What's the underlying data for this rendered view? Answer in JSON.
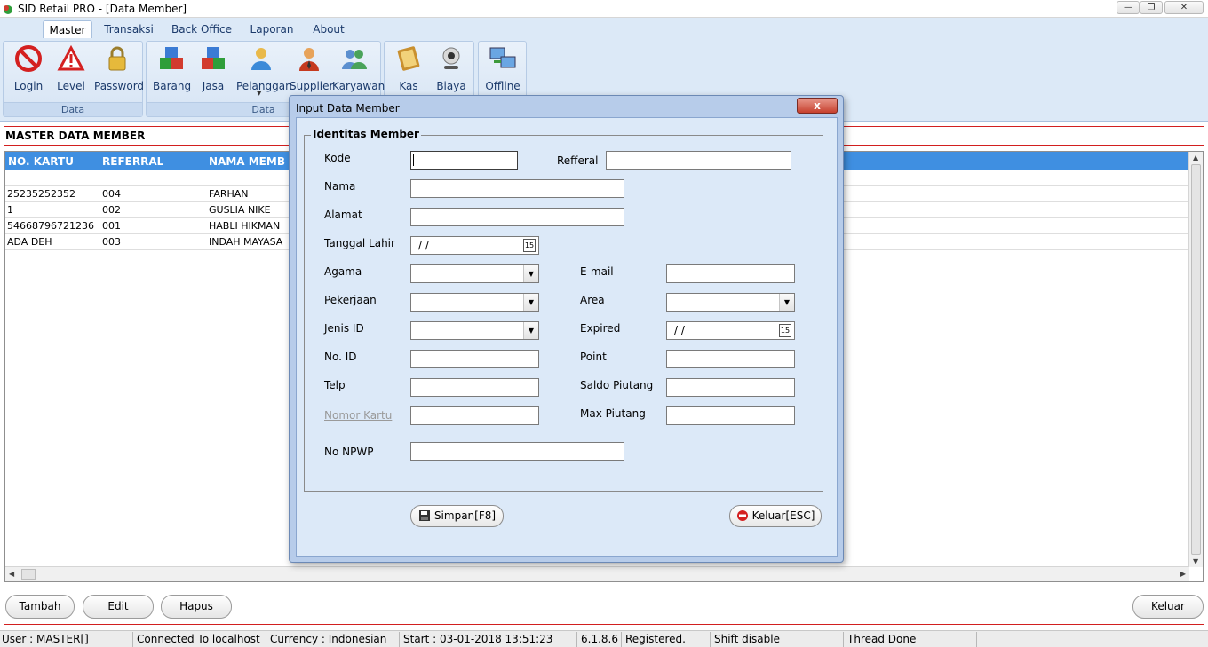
{
  "window": {
    "title": "SID Retail PRO - [Data Member]",
    "minimize": "—",
    "restore": "❐",
    "close": "✕"
  },
  "ribbon": {
    "tabs": [
      "Master",
      "Transaksi",
      "Back Office",
      "Laporan",
      "About"
    ],
    "group1": {
      "label": "Data",
      "buttons": [
        "Login",
        "Level",
        "Password"
      ]
    },
    "group2": {
      "label": "Data",
      "buttons": [
        "Barang",
        "Jasa",
        "Pelanggan",
        "Supplier",
        "Karyawan"
      ]
    },
    "group3": {
      "buttons": [
        "Kas",
        "Biaya"
      ]
    },
    "group4": {
      "buttons": [
        "Offline"
      ]
    }
  },
  "master": {
    "title": "MASTER DATA MEMBER",
    "columns": [
      "NO. KARTU",
      "REFERRAL",
      "NAMA MEMB"
    ],
    "rows": [
      {
        "kartu": "25235252352",
        "ref": "004",
        "nama": "FARHAN"
      },
      {
        "kartu": "1",
        "ref": "002",
        "nama": "GUSLIA NIKE"
      },
      {
        "kartu": "54668796721236",
        "ref": "001",
        "nama": "HABLI HIKMAN"
      },
      {
        "kartu": "ADA DEH",
        "ref": "003",
        "nama": "INDAH MAYASA"
      }
    ]
  },
  "actions": {
    "tambah": "Tambah",
    "edit": "Edit",
    "hapus": "Hapus",
    "keluar": "Keluar"
  },
  "status": {
    "user": "User : MASTER[]",
    "connection": "Connected To localhost",
    "currency": "Currency : Indonesian",
    "start": "Start  : 03-01-2018 13:51:23",
    "version": "6.1.8.6",
    "registered": "Registered.",
    "shift": "Shift disable",
    "thread": "Thread Done"
  },
  "dialog": {
    "title": "Input Data Member",
    "close": "x",
    "group": "Identitas Member",
    "labels": {
      "kode": "Kode",
      "refferal": "Refferal",
      "nama": "Nama",
      "alamat": "Alamat",
      "tanggal_lahir": "Tanggal Lahir",
      "agama": "Agama",
      "email": "E-mail",
      "pekerjaan": "Pekerjaan",
      "area": "Area",
      "jenis_id": "Jenis ID",
      "expired": "Expired",
      "no_id": "No. ID",
      "point": "Point",
      "telp": "Telp",
      "saldo_piutang": "Saldo Piutang",
      "nomor_kartu": "Nomor Kartu",
      "max_piutang": "Max Piutang",
      "no_npwp": "No NPWP"
    },
    "values": {
      "tanggal_lahir": "/  /",
      "expired": "/  /"
    },
    "simpan": "Simpan[F8]",
    "keluar": "Keluar[ESC]"
  },
  "colors": {
    "header_blue": "#3f8fe1",
    "divider_red": "#d21f1f",
    "ribbon_bg": "#dce9f7",
    "dialog_bg": "#dce9f8"
  }
}
